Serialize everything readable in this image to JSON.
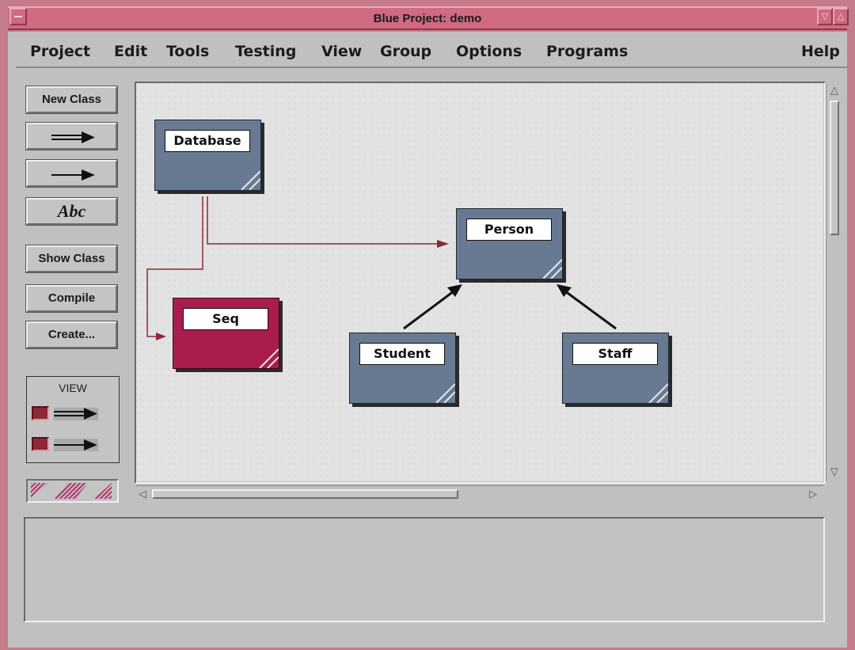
{
  "window": {
    "title": "Blue Project: demo"
  },
  "menubar": {
    "items": [
      "Project",
      "Edit",
      "Tools",
      "Testing",
      "View",
      "Group",
      "Options",
      "Programs"
    ],
    "help": "Help"
  },
  "toolbar": {
    "new_class": "New Class",
    "inherits_arrow": "inherits-arrow-icon",
    "uses_arrow": "uses-arrow-icon",
    "text_tool": "Abc",
    "show_class": "Show Class",
    "compile": "Compile",
    "create": "Create..."
  },
  "view_panel": {
    "label": "VIEW",
    "show_inheritance": true,
    "show_uses": true
  },
  "diagram": {
    "classes": [
      {
        "name": "Database",
        "color": "#687a92"
      },
      {
        "name": "Seq",
        "color": "#a81d4e"
      },
      {
        "name": "Person",
        "color": "#687a92"
      },
      {
        "name": "Student",
        "color": "#687a92"
      },
      {
        "name": "Staff",
        "color": "#687a92"
      }
    ],
    "relations": [
      {
        "from": "Database",
        "to": "Person",
        "type": "uses"
      },
      {
        "from": "Database",
        "to": "Seq",
        "type": "uses"
      },
      {
        "from": "Student",
        "to": "Person",
        "type": "inherits"
      },
      {
        "from": "Staff",
        "to": "Person",
        "type": "inherits"
      }
    ],
    "uses_color": "#8b2a36",
    "inherits_color": "#111111"
  },
  "message_area": {
    "text": ""
  }
}
